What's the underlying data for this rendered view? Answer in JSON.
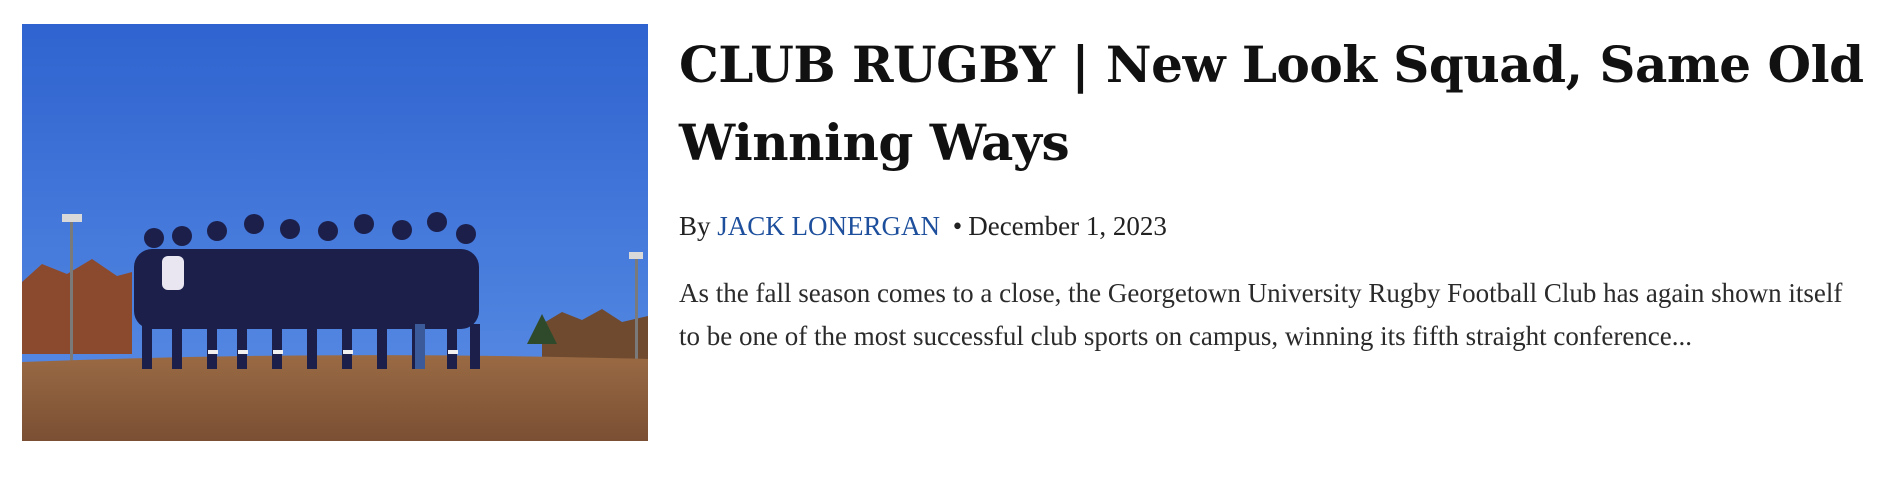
{
  "article": {
    "title": "CLUB RUGBY | New Look Squad, Same Old Winning Ways",
    "byline_prefix": "By",
    "author": "JACK LONERGAN",
    "separator": "•",
    "date": "December 1, 2023",
    "excerpt": "As the fall season comes to a close, the Georgetown University Rugby Football Club has again shown itself to be one of the most successful club sports on campus, winning its fifth straight conference...",
    "image_alt": "Rugby team huddled on a field under a blue sky"
  },
  "colors": {
    "author_link": "#1d4f9c",
    "headline": "#111111",
    "sky": "#3a6fd6",
    "field": "#8a5a3a"
  }
}
